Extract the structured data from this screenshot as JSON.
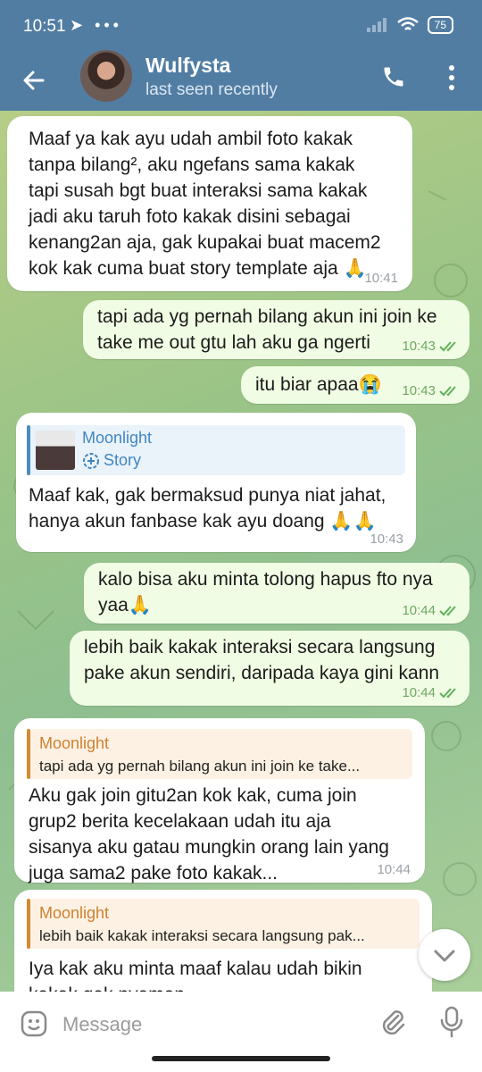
{
  "status_bar": {
    "time": "10:51",
    "left_icons": "➤ •••",
    "battery": "75"
  },
  "header": {
    "name": "Wulfysta",
    "status": "last seen recently"
  },
  "messages": [
    {
      "direction": "incoming",
      "text": "Maaf ya kak ayu udah ambil foto kakak\ntanpa bilang², aku ngefans sama kakak\ntapi susah bgt buat interaksi sama kakak\njadi aku taruh foto kakak disini sebagai\nkenang2an aja, gak kupakai buat macem2\nkok kak cuma buat story template aja 🙏",
      "time": "10:41"
    },
    {
      "direction": "outgoing",
      "text": "tapi ada yg pernah bilang akun ini join ke\ntake me out gtu lah aku ga ngerti",
      "time": "10:43"
    },
    {
      "direction": "outgoing",
      "text": "itu biar apaa😭",
      "time": "10:43"
    },
    {
      "direction": "incoming",
      "reply_name": "Moonlight",
      "reply_text": "Story",
      "text": "Maaf kak, gak bermaksud punya niat jahat,\nhanya akun fanbase kak ayu doang 🙏🙏",
      "time": "10:43"
    },
    {
      "direction": "outgoing",
      "text": "kalo bisa aku minta tolong hapus fto nya\nyaa🙏",
      "time": "10:44"
    },
    {
      "direction": "outgoing",
      "text": "lebih baik kakak interaksi secara langsung\npake akun sendiri, daripada kaya gini kann",
      "time": "10:44"
    },
    {
      "direction": "incoming",
      "reply_name": "Moonlight",
      "reply_text": "tapi ada yg pernah bilang akun ini join ke take...",
      "text": "Aku gak join gitu2an kok kak, cuma join\ngrup2 berita kecelakaan udah itu aja\nsisanya aku gatau mungkin orang lain yang\njuga sama2 pake foto kakak...",
      "time": "10:44"
    },
    {
      "direction": "incoming",
      "reply_name": "Moonlight",
      "reply_text": "lebih baik kakak interaksi secara langsung pak...",
      "text": "Iya kak aku minta maaf kalau udah bikin\nkakak gak nyaman"
    }
  ],
  "input": {
    "placeholder": "Message"
  },
  "colors": {
    "header": "#527da3",
    "incoming_bubble": "#ffffff",
    "outgoing_bubble": "#f0fde4",
    "reply_blue": "#4a8dc2",
    "reply_orange": "#d38a33",
    "tick_green": "#5fb05a"
  },
  "icons": [
    "back-arrow-icon",
    "phone-icon",
    "more-vert-icon",
    "telegram-send-icon",
    "wifi-icon",
    "signal-icon",
    "battery-icon",
    "story-icon",
    "double-check-icon",
    "chevron-down-icon",
    "emoji-icon",
    "attach-icon",
    "mic-icon"
  ]
}
